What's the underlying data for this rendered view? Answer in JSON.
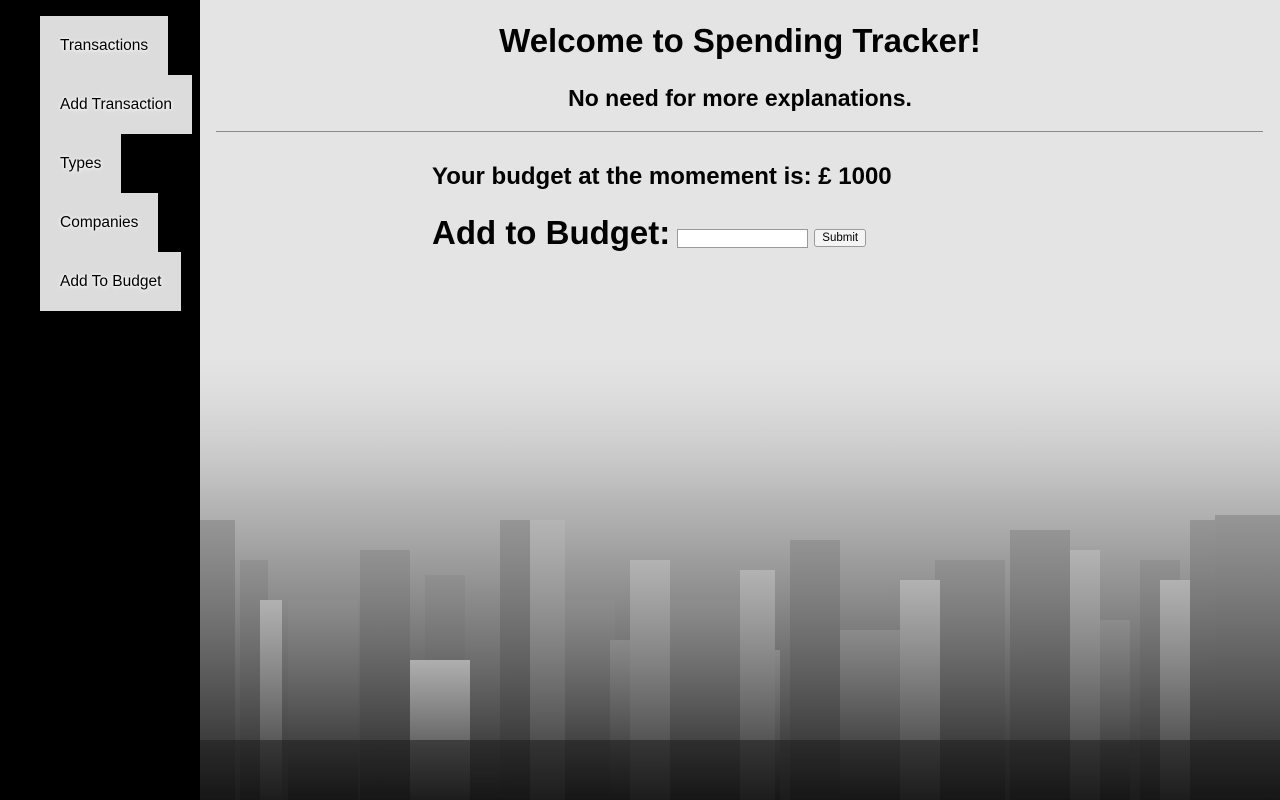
{
  "sidebar": {
    "items": [
      {
        "label": "Transactions"
      },
      {
        "label": "Add Transaction"
      },
      {
        "label": "Types"
      },
      {
        "label": "Companies"
      },
      {
        "label": "Add To Budget"
      }
    ]
  },
  "main": {
    "title": "Welcome to Spending Tracker!",
    "subtitle": "No need for more explanations.",
    "budget_text": "Your budget at the momement is: £ 1000",
    "add_label": "Add to Budget:",
    "add_input_value": "",
    "submit_label": "Submit"
  }
}
